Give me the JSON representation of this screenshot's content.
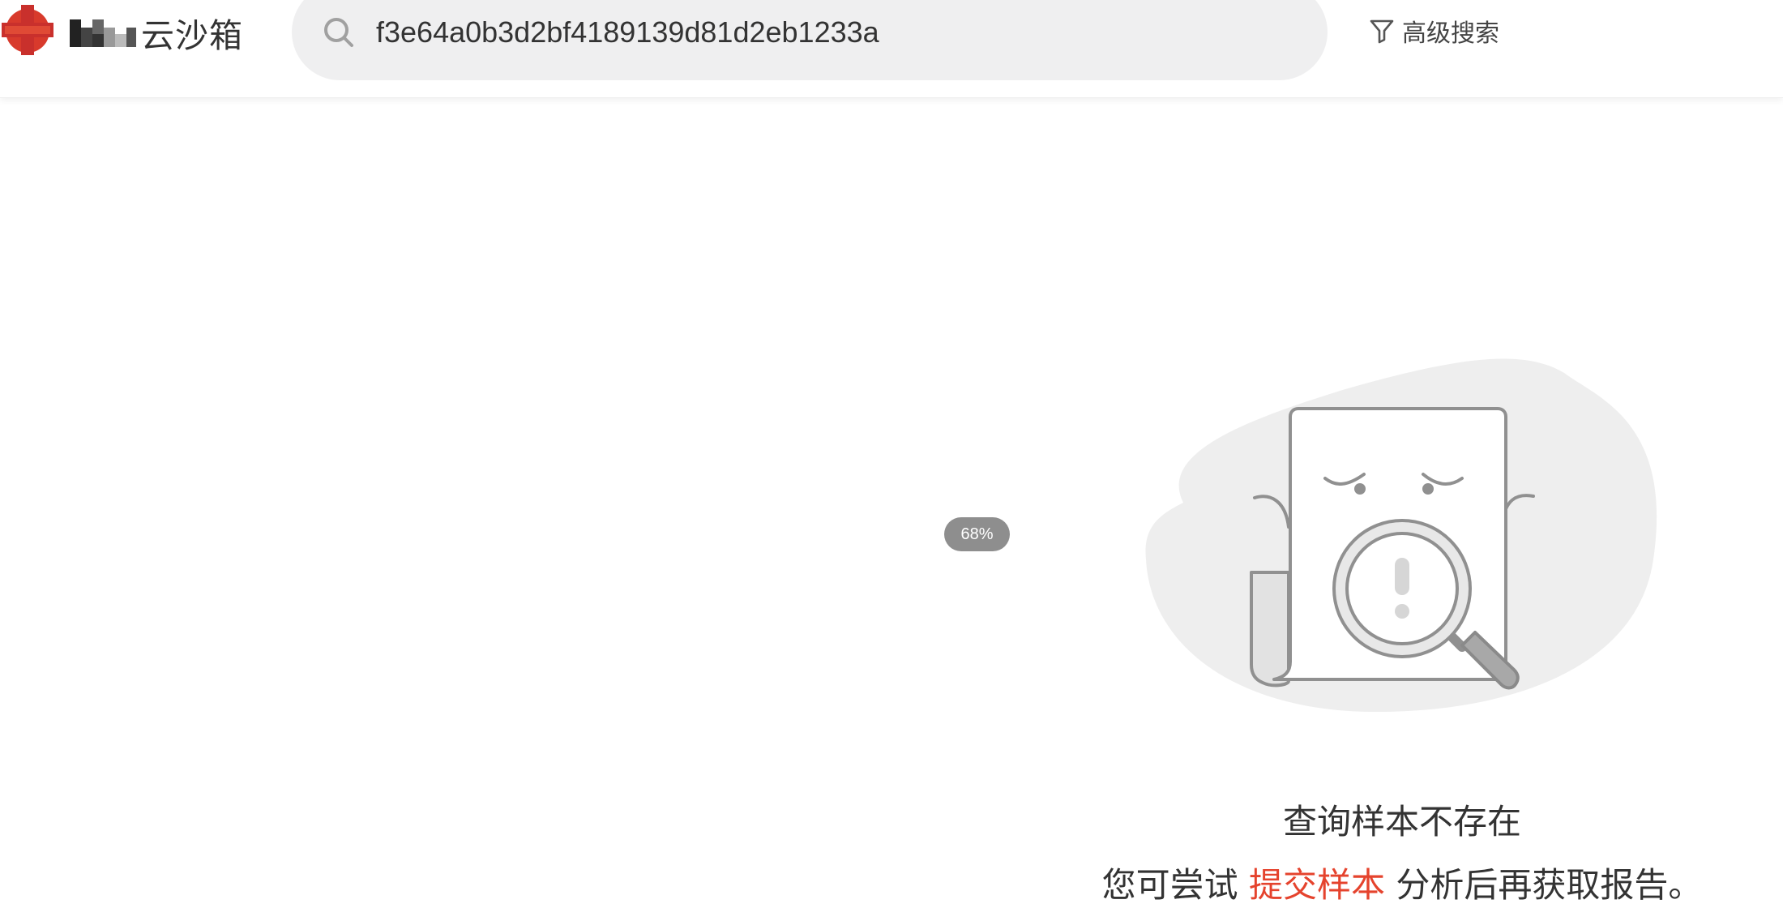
{
  "header": {
    "logo": {
      "text": "云沙箱",
      "icon": "red-cross-logo-icon",
      "pixel_mark": "pixelated-brand-mark"
    },
    "search": {
      "icon": "search-icon",
      "value": "f3e64a0b3d2bf4189139d81d2eb1233a",
      "placeholder": ""
    },
    "advanced_search": {
      "icon": "filter-icon",
      "label": "高级搜索"
    }
  },
  "zoom": {
    "label": "68%",
    "value_percent": 68
  },
  "empty_state": {
    "illustration": "document-magnifier-not-found-illustration",
    "title": "查询样本不存在",
    "hint_prefix": "您可尝试",
    "link_label": "提交样本",
    "hint_suffix": "分析后再获取报告。"
  },
  "colors": {
    "accent": "#e5432d",
    "search_bg": "#efeff0",
    "text": "#333333",
    "zoom_badge_bg": "#8e8e8e",
    "illustration_blob": "#eeeeee"
  }
}
